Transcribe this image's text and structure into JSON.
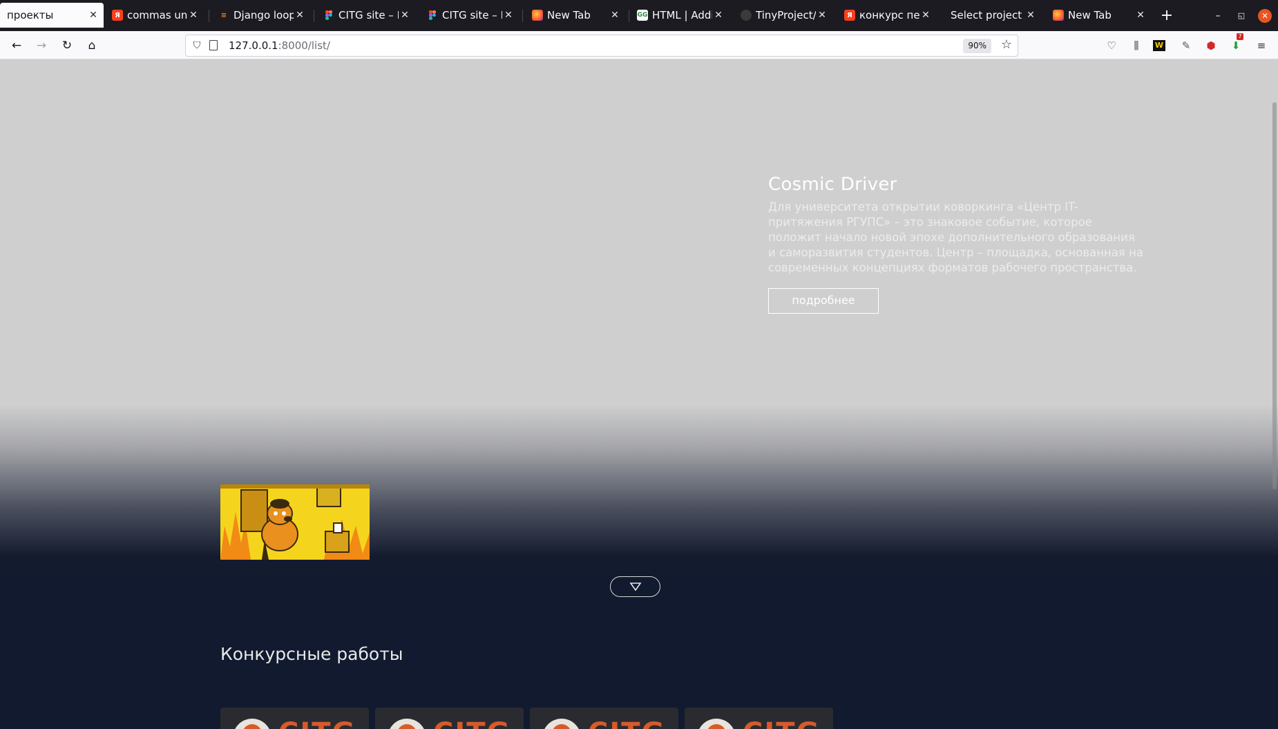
{
  "browser": {
    "tabs": [
      {
        "title": "проекты",
        "favicon": "blank",
        "active": true
      },
      {
        "title": "commas until l",
        "favicon": "yandex"
      },
      {
        "title": "Django loop –",
        "favicon": "stackoverflow"
      },
      {
        "title": "CITG site – Fig",
        "favicon": "figma"
      },
      {
        "title": "CITG site – Fig",
        "favicon": "figma"
      },
      {
        "title": "New Tab",
        "favicon": "firefox"
      },
      {
        "title": "HTML | Adding",
        "favicon": "gfg"
      },
      {
        "title": "TinyProject/cu",
        "favicon": "github"
      },
      {
        "title": "конкурс перез",
        "favicon": "yandex"
      },
      {
        "title": "Select project to",
        "favicon": "none"
      },
      {
        "title": "New Tab",
        "favicon": "firefox"
      }
    ],
    "url_host": "127.0.0.1",
    "url_rest": ":8000/list/",
    "zoom": "90%",
    "extension_badge": "7"
  },
  "hero": {
    "title": "Cosmic Driver",
    "description": "Для университета открытии коворкинга «Центр IT-притяжения РГУПС» – это знаковое событие, которое положит начало новой эпохе дополнительного образования и саморазвития студентов. Центр – площадка, основанная на современных концепциях форматов рабочего пространства.",
    "more_button": "подробнее"
  },
  "section": {
    "title": "Конкурсные работы"
  },
  "cards": [
    {
      "logo_text": "CITG"
    },
    {
      "logo_text": "CITG"
    },
    {
      "logo_text": "CITG"
    },
    {
      "logo_text": "CITG"
    }
  ],
  "colors": {
    "page_bg_dark": "#111a2e",
    "hero_bg": "#cfcfcf",
    "accent_logo": "#d65a2c"
  }
}
